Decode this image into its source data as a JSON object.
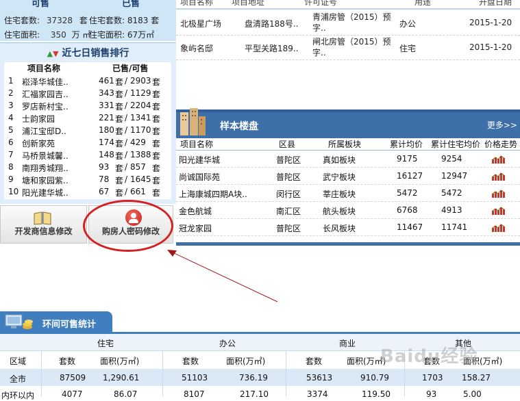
{
  "top_stats": {
    "col1_header": "可售",
    "col2_header": "已售",
    "rows": [
      {
        "l_label": "住宅套数:",
        "l_value": "37328",
        "l_unit": "套",
        "r_text": "住宅套数: 8183 套"
      },
      {
        "l_label": "住宅面积:",
        "l_value": "350",
        "l_unit": "万 ㎡",
        "r_text": "住宅面积: 67万㎡"
      }
    ]
  },
  "ranking": {
    "title": "近七日销售排行",
    "col_name": "项目名称",
    "col_sold": "已售/可售",
    "rows": [
      {
        "no": "1",
        "name": "崧泽华城佳..",
        "sold": "461",
        "total": "2903"
      },
      {
        "no": "2",
        "name": "汇福家园吉..",
        "sold": "343",
        "total": "1129"
      },
      {
        "no": "3",
        "name": "罗店新村宝..",
        "sold": "331",
        "total": "2204"
      },
      {
        "no": "4",
        "name": "士韵家园",
        "sold": "221",
        "total": "1341"
      },
      {
        "no": "5",
        "name": "浦江宝邸D..",
        "sold": "180",
        "total": "1170"
      },
      {
        "no": "6",
        "name": "创新家苑",
        "sold": "174",
        "total": "429"
      },
      {
        "no": "7",
        "name": "马桥景城馨..",
        "sold": "148",
        "total": "1388"
      },
      {
        "no": "8",
        "name": "南翔秀城翔..",
        "sold": "93",
        "total": "857"
      },
      {
        "no": "9",
        "name": "塘和家园紫..",
        "sold": "78",
        "total": "1645"
      },
      {
        "no": "10",
        "name": "阳光建华城..",
        "sold": "67",
        "total": "661"
      }
    ],
    "unit": "套"
  },
  "buttons": {
    "developer": "开发商信息修改",
    "buyer_password": "购房人密码修改"
  },
  "permit_table": {
    "headers": [
      "项目名称",
      "项目地址",
      "许可证号",
      "用途",
      "开盘日期"
    ],
    "rows": [
      {
        "name": "北极星广场",
        "address": "盘清路188号..",
        "permit": "青浦房管（2015）预字..",
        "use": "办公",
        "date": "2015-1-20"
      },
      {
        "name": "象屿名邸",
        "address": "平型关路189..",
        "permit": "闸北房管（2015）预字..",
        "use": "住宅",
        "date": "2015-1-20"
      }
    ]
  },
  "sample": {
    "title": "样本楼盘",
    "more": "更多>>",
    "headers": [
      "项目名称",
      "区县",
      "所属板块",
      "累计均价",
      "累计住宅均价",
      "价格走势"
    ],
    "rows": [
      {
        "name": "阳光建华城",
        "district": "普陀区",
        "block": "真如板块",
        "avg": "9175",
        "res_avg": "9254"
      },
      {
        "name": "尚诚国际苑",
        "district": "普陀区",
        "block": "武宁板块",
        "avg": "16127",
        "res_avg": "12947"
      },
      {
        "name": "上海康城四期A块..",
        "district": "闵行区",
        "block": "莘庄板块",
        "avg": "5472",
        "res_avg": "5472"
      },
      {
        "name": "金色航城",
        "district": "南汇区",
        "block": "航头板块",
        "avg": "6768",
        "res_avg": "4913"
      },
      {
        "name": "冠龙家园",
        "district": "普陀区",
        "block": "长风板块",
        "avg": "11467",
        "res_avg": "11741"
      }
    ]
  },
  "ring_stats": {
    "title": "环间可售统计",
    "groups": [
      "住宅",
      "办公",
      "商业",
      "其他"
    ],
    "col_region": "区域",
    "col_sets": "套数",
    "col_area": "面积(万㎡)",
    "rows": [
      {
        "region": "全市",
        "v": [
          "87509",
          "1,290.61",
          "51103",
          "736.19",
          "53613",
          "910.79",
          "1703",
          "158.27"
        ]
      },
      {
        "region": "内环以内",
        "v": [
          "4077",
          "86.07",
          "8107",
          "217.10",
          "3374",
          "119.50",
          "93",
          "5.00"
        ]
      }
    ]
  },
  "watermark": "Baidu经验",
  "colors": {
    "accent_blue": "#3f6fa8",
    "annotation_red": "#d42020",
    "light_blue": "#cfe6f7"
  }
}
